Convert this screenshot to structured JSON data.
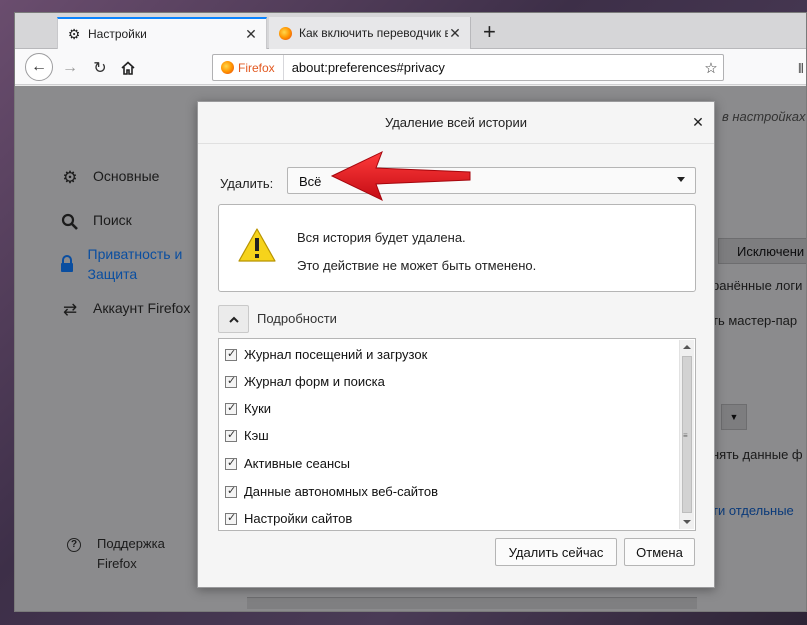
{
  "browser": {
    "tabs": [
      {
        "label": "Настройки",
        "icon": "gear-icon",
        "active": true
      },
      {
        "label": "Как включить переводчик в М",
        "icon": "firefox-icon",
        "active": false
      }
    ],
    "close_glyph": "✕",
    "new_tab_glyph": "+",
    "url_identity": "Firefox",
    "url": "about:preferences#privacy"
  },
  "sidebar": {
    "items": [
      {
        "label": "Основные",
        "icon": "gear-icon"
      },
      {
        "label": "Поиск",
        "icon": "search-icon"
      },
      {
        "label": "Приватность и Защита",
        "icon": "lock-icon",
        "selected": true
      },
      {
        "label": "Аккаунт Firefox",
        "icon": "sync-icon"
      }
    ],
    "support": "Поддержка Firefox"
  },
  "background": {
    "search_hint": "в настройках",
    "exceptions_button": "Исключени",
    "saved_logins": "ранённые логи",
    "master_password": "ть мастер-пар",
    "clear_data": "нять данные ф",
    "individual": "ти отдельные"
  },
  "dialog": {
    "title": "Удаление всей истории",
    "range_label": "Удалить:",
    "range_value": "Всё",
    "warning_line1": "Вся история будет удалена.",
    "warning_line2": "Это действие не может быть отменено.",
    "details_label": "Подробности",
    "items": [
      {
        "label": "Журнал посещений и загрузок",
        "checked": true
      },
      {
        "label": "Журнал форм и поиска",
        "checked": true
      },
      {
        "label": "Куки",
        "checked": true
      },
      {
        "label": "Кэш",
        "checked": true
      },
      {
        "label": "Активные сеансы",
        "checked": true
      },
      {
        "label": "Данные автономных веб-сайтов",
        "checked": true
      },
      {
        "label": "Настройки сайтов",
        "checked": true
      }
    ],
    "clear_button": "Удалить сейчас",
    "cancel_button": "Отмена"
  },
  "colors": {
    "annotation_arrow": "#e3121b",
    "accent": "#0a84ff",
    "warning_yellow": "#f6d31b"
  }
}
